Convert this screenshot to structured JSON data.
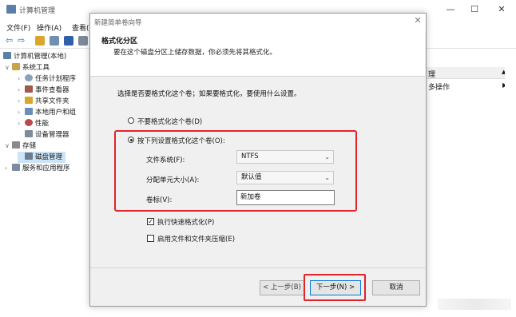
{
  "window": {
    "title": "计算机管理",
    "buttons": {
      "minimize": "—",
      "maximize": "☐",
      "close": "✕"
    }
  },
  "menu": {
    "file": "文件(F)",
    "action": "操作(A)",
    "view": "查看("
  },
  "toolbar": {
    "back": "⇦",
    "forward": "⇨"
  },
  "tree": {
    "root": "计算机管理(本地)",
    "system_tools": "系统工具",
    "task_scheduler": "任务计划程序",
    "event_viewer": "事件查看器",
    "shared_folders": "共享文件夹",
    "local_users": "本地用户和组",
    "performance": "性能",
    "device_manager": "设备管理器",
    "storage": "存储",
    "disk_management": "磁盘管理",
    "services": "服务和应用程序",
    "expanded_arrow": "∨",
    "collapsed_arrow": "›"
  },
  "actions": {
    "header": "理",
    "more": "多操作",
    "header_caret": "▲",
    "more_caret": "▶"
  },
  "wizard": {
    "title": "新建简单卷向导",
    "close": "✕",
    "heading": "格式化分区",
    "subheading": "要在这个磁盘分区上储存数据，你必须先将其格式化。",
    "question": "选择是否要格式化这个卷；如果要格式化，要使用什么设置。",
    "radio_no_format": "不要格式化这个卷(D)",
    "radio_format": "按下列设置格式化这个卷(O):",
    "selected_option": "format",
    "file_system_label": "文件系统(F):",
    "file_system_value": "NTFS",
    "alloc_label": "分配单元大小(A):",
    "alloc_value": "默认值",
    "volume_label": "卷标(V):",
    "volume_value": "新加卷",
    "quick_format_label": "执行快速格式化(P)",
    "quick_format_checked": true,
    "compression_label": "启用文件和文件夹压缩(E)",
    "compression_checked": false,
    "select_caret": "⌄",
    "back_button": "< 上一步(B)",
    "next_button": "下一步(N) >",
    "cancel_button": "取消"
  },
  "colors": {
    "highlight": "#e0242a",
    "selected_tree": "#cce4f7",
    "accent": "#0078d7"
  }
}
